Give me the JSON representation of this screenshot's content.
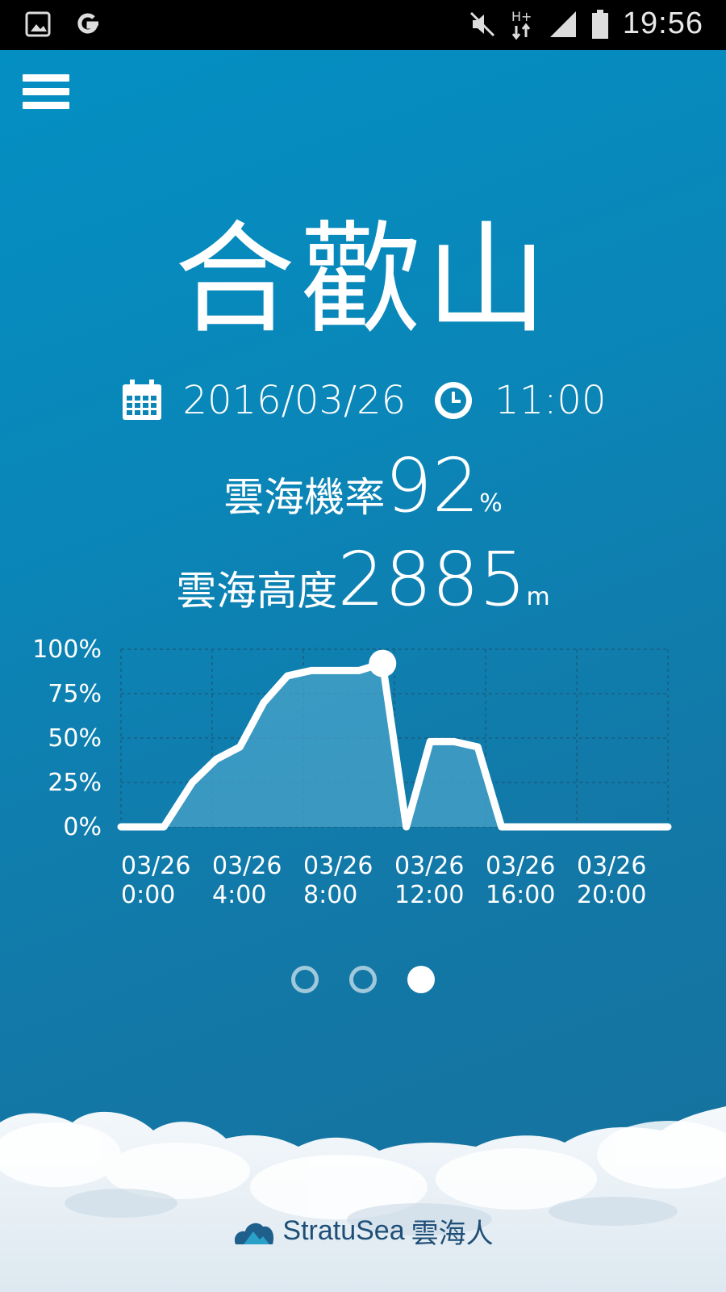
{
  "status_bar": {
    "time": "19:56",
    "left_icons": [
      "gallery-icon",
      "google-icon"
    ],
    "right_icons": [
      "mute-icon",
      "hplus-data-icon",
      "signal-icon",
      "battery-icon"
    ]
  },
  "location": {
    "name": "合歡山"
  },
  "forecast": {
    "date": "2016/03/26",
    "time": "11:00",
    "probability_label": "雲海機率",
    "probability_value": "92",
    "probability_unit": "%",
    "height_label": "雲海高度",
    "height_value": "2885",
    "height_unit": "m"
  },
  "chart_data": {
    "type": "area",
    "y_ticks": [
      "100%",
      "75%",
      "50%",
      "25%",
      "0%"
    ],
    "x_ticks": [
      {
        "line1": "03/26",
        "line2": "0:00"
      },
      {
        "line1": "03/26",
        "line2": "4:00"
      },
      {
        "line1": "03/26",
        "line2": "8:00"
      },
      {
        "line1": "03/26",
        "line2": "12:00"
      },
      {
        "line1": "03/26",
        "line2": "16:00"
      },
      {
        "line1": "03/26",
        "line2": "20:00"
      }
    ],
    "ylim": [
      0,
      100
    ],
    "xlim": [
      0,
      23
    ],
    "x": [
      0,
      1,
      1.8,
      3,
      4,
      5,
      6,
      7,
      8,
      9,
      10,
      11,
      12,
      13,
      14,
      15,
      16,
      17,
      18,
      20,
      23
    ],
    "y": [
      0,
      0,
      0,
      25,
      38,
      45,
      70,
      85,
      88,
      88,
      88,
      92,
      0,
      48,
      48,
      45,
      0,
      0,
      0,
      0,
      0
    ],
    "highlight_x": 11,
    "grid": true,
    "colors": {
      "line": "#ffffff",
      "fill": "#4aa3c8",
      "grid": "#1a5e82"
    }
  },
  "pager": {
    "count": 3,
    "active": 2
  },
  "branding": {
    "name": "StratuSea",
    "name_cn": "雲海人",
    "logo_icon": "cloud-mountain-logo-icon"
  }
}
